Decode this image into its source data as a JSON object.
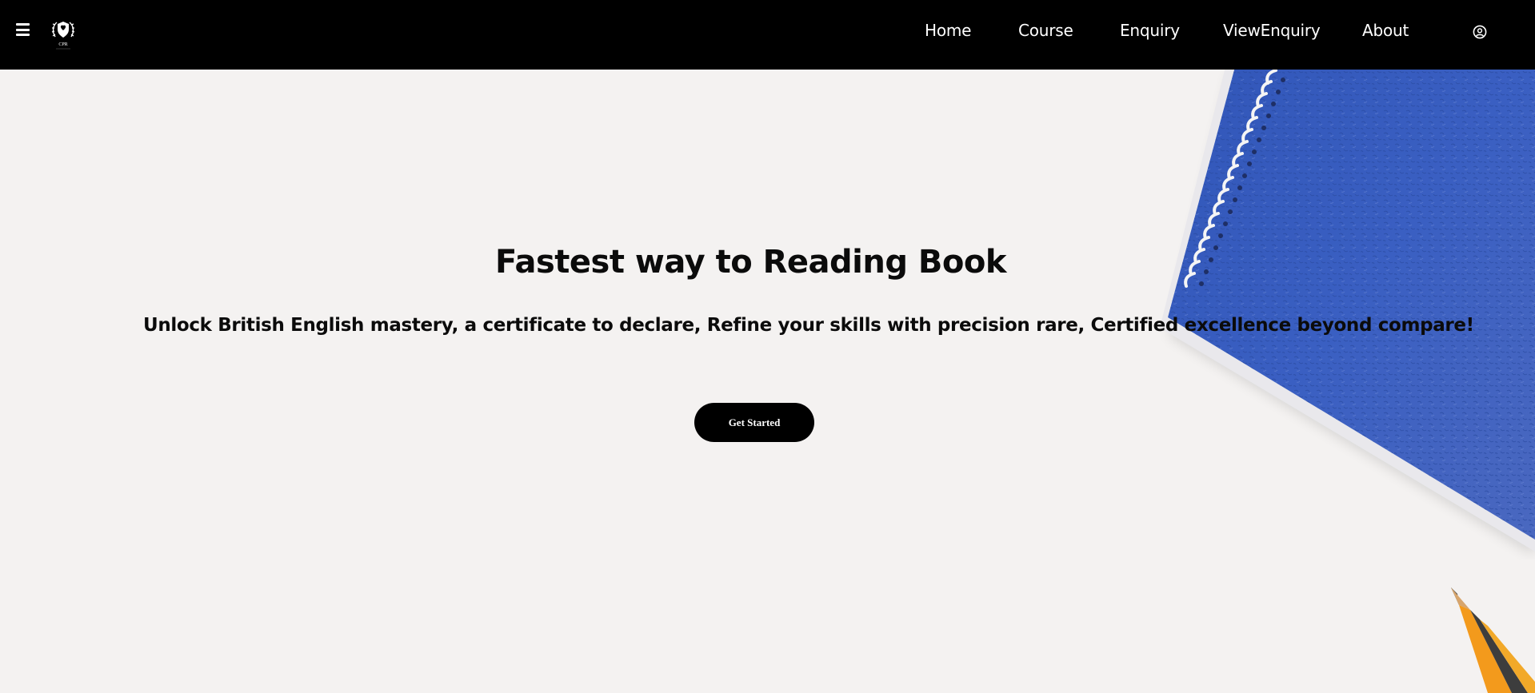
{
  "navbar": {
    "menu_icon": "hamburger-menu-icon",
    "logo_icon": "laurel-shield-logo",
    "links": [
      {
        "label": "Home"
      },
      {
        "label": "Course"
      },
      {
        "label": "Enquiry"
      },
      {
        "label": "ViewEnquiry"
      },
      {
        "label": "About"
      }
    ],
    "user_icon": "user-circle-icon"
  },
  "hero": {
    "title": "Fastest way to Reading Book",
    "subtitle": "Unlock British English mastery, a certificate to declare, Refine your skills with precision rare, Certified excellence beyond compare!",
    "cta_label": "Get Started"
  },
  "colors": {
    "navbar_bg": "#000000",
    "page_bg": "#f4f2f1",
    "notebook_blue": "#3a5fbf",
    "text": "#0b0b0b",
    "button_bg": "#000000"
  }
}
